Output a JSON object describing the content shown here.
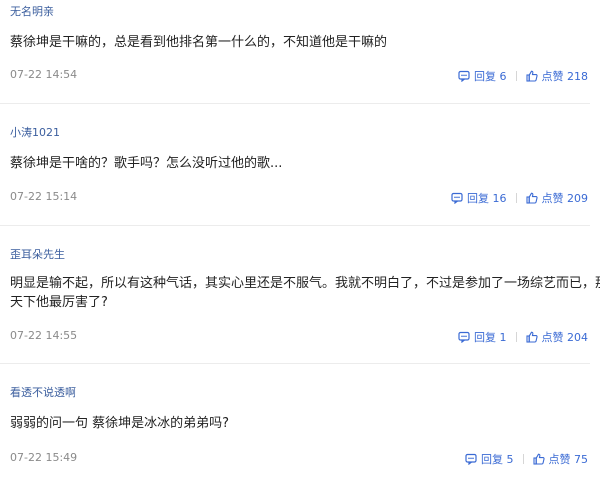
{
  "comments": [
    {
      "username": "无名明亲",
      "text": "蔡徐坤是干嘛的，总是看到他排名第一什么的，不知道他是干嘛的",
      "time": "07-22 14:54",
      "reply_label": "回复 6",
      "like_label": "点赞 218"
    },
    {
      "username": "小涛1021",
      "text": "蔡徐坤是干啥的？歌手吗？怎么没听过他的歌...",
      "time": "07-22 15:14",
      "reply_label": "回复 16",
      "like_label": "点赞 209"
    },
    {
      "username": "歪耳朵先生",
      "text": "明显是输不起，所以有这种气话，其实心里还是不服气。我就不明白了，不过是参加了一场综艺而已，那\n天下他最厉害了?",
      "time": "07-22 14:55",
      "reply_label": "回复 1",
      "like_label": "点赞 204"
    },
    {
      "username": "看透不说透啊",
      "text": "弱弱的问一句 蔡徐坤是冰冰的弟弟吗?",
      "time": "07-22 15:49",
      "reply_label": "回复 5",
      "like_label": "点赞 75"
    }
  ],
  "icons": {
    "reply": "comment-bubble-icon",
    "like": "thumbs-up-icon"
  },
  "colors": {
    "username": "#3b5e9e",
    "action": "#3a6ad4",
    "text": "#222222",
    "time": "#8a8a8a"
  }
}
